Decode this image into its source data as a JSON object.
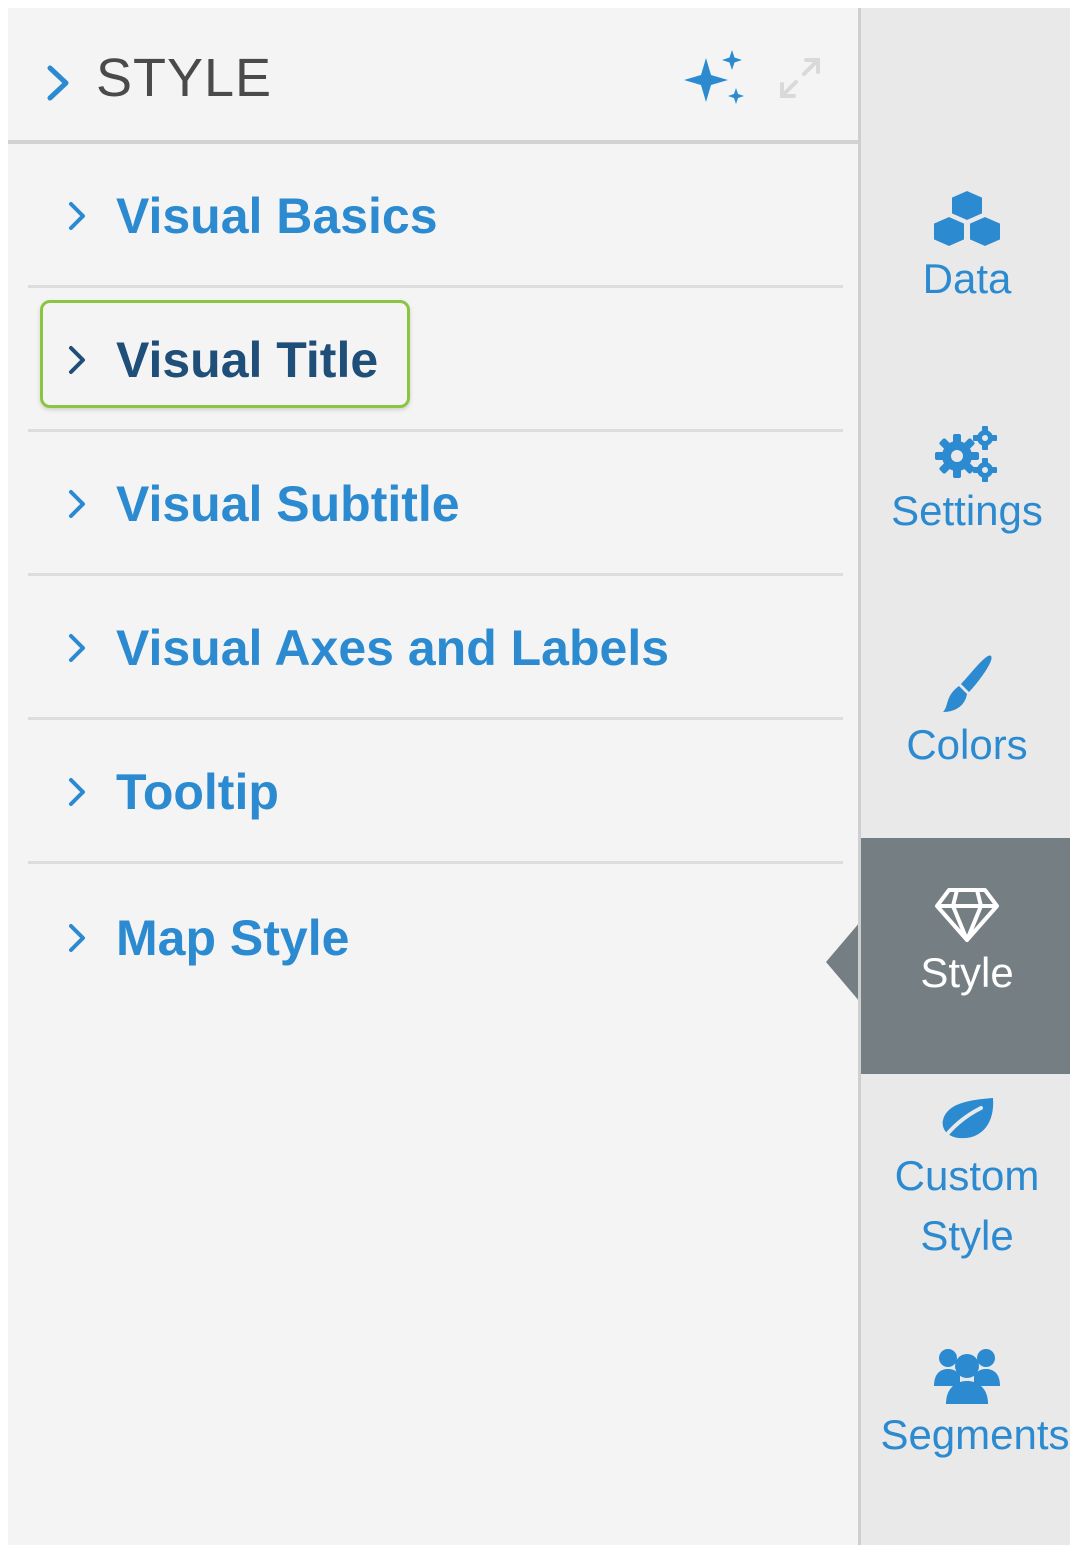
{
  "panel": {
    "title": "STYLE",
    "icons": [
      "chevron-right-icon",
      "sparkle-icon",
      "expand-icon"
    ]
  },
  "sections": [
    {
      "label": "Visual Basics",
      "highlighted": false
    },
    {
      "label": "Visual Title",
      "highlighted": true
    },
    {
      "label": "Visual Subtitle",
      "highlighted": false
    },
    {
      "label": "Visual Axes and Labels",
      "highlighted": false
    },
    {
      "label": "Tooltip",
      "highlighted": false
    },
    {
      "label": "Map Style",
      "highlighted": false
    }
  ],
  "rail": {
    "tabs": [
      {
        "label": "Data",
        "icon": "cubes-icon",
        "active": false
      },
      {
        "label": "Settings",
        "icon": "gears-icon",
        "active": false
      },
      {
        "label": "Colors",
        "icon": "brush-icon",
        "active": false
      },
      {
        "label": "Style",
        "icon": "diamond-icon",
        "active": true
      },
      {
        "label_line1": "Custom",
        "label_line2": "Style",
        "icon": "leaf-icon",
        "active": false
      },
      {
        "label": "Segments",
        "icon": "users-icon",
        "active": false
      }
    ]
  },
  "colors": {
    "accent_blue": "#2b8ad0",
    "highlight_text": "#1f4e79",
    "highlight_border": "#8ac542",
    "active_tab_bg": "#757e82",
    "panel_bg": "#f4f4f4"
  }
}
